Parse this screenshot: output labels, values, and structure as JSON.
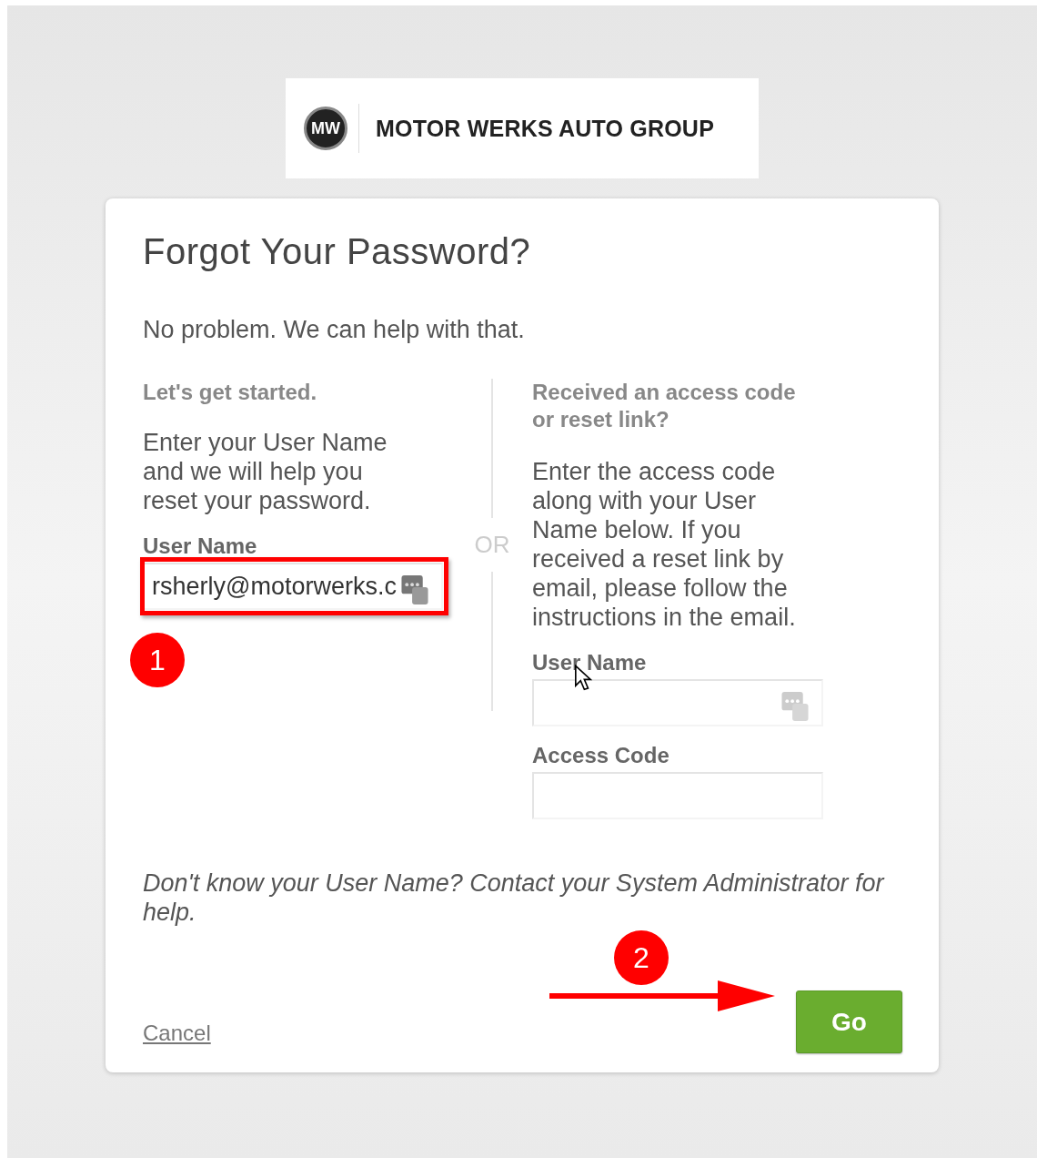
{
  "logo": {
    "monogram": "MW",
    "name": "MOTOR WERKS AUTO GROUP"
  },
  "title": "Forgot Your Password?",
  "intro": "No problem. We can help with that.",
  "left": {
    "heading": "Let's get started.",
    "text": "Enter your User Name and we will help you reset your password.",
    "label": "User Name",
    "value": "rsherly@motorwerks.c",
    "highlighted": true
  },
  "divider_text": "OR",
  "right": {
    "heading": "Received an access code or reset link?",
    "text": "Enter the access code along with your User Name below. If you received a reset link by email, please follow the instructions in the email.",
    "fields": [
      {
        "label": "User Name",
        "badge_icon": true
      },
      {
        "label": "Access Code",
        "badge_icon": false
      }
    ]
  },
  "help": "Don't know your User Name? Contact your System Administrator for help.",
  "cancel": "Cancel",
  "go": "Go",
  "callouts": [
    "1",
    "2"
  ]
}
